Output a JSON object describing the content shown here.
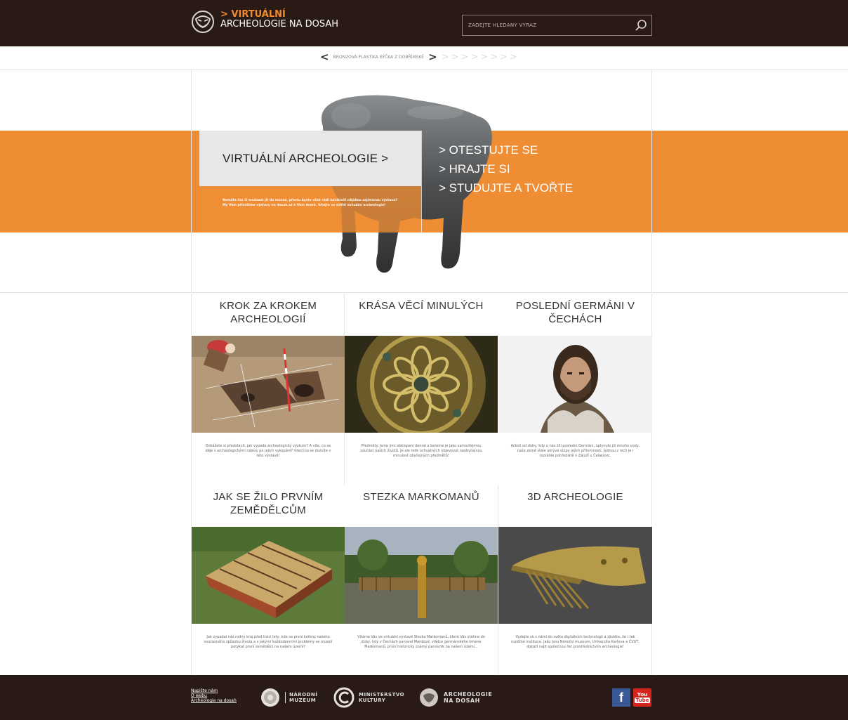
{
  "header": {
    "logo_accent": "> VIRTUÁLNÍ",
    "logo_line2": "ARCHEOLOGIE NA DOSAH",
    "search_placeholder": "ZADEJTE HLEDANÝ VÝRAZ"
  },
  "breadcrumb": {
    "prev": "<",
    "current": "BRONZOVÁ PLASTIKA BÝČKA Z DOBŘÍMSKÉ",
    "next": ">",
    "trail": ">>>>>>>>"
  },
  "hero": {
    "title": "VIRTUÁLNÍ ARCHEOLOGIE   >",
    "intro": "Nemáte čas či možnost jít do muzea, přesto byste však rádi navštívili nějakou zajímavou výstavu? My Vám přinášíme výstavy na dosah až k Vám domů. Vítejte ve světě virtuální archeologie!",
    "menu": [
      "> OTESTUJTE SE",
      "> HRAJTE SI",
      "> STUDUJTE A TVOŘTE"
    ]
  },
  "cards": [
    {
      "title": "KROK ZA KROKEM ARCHEOLOGIÍ",
      "desc": "Dokážete si představit, jak vypadá archeologický výzkum? A víte, co se děje s archeologickými nálezy po jejich vykopání? Všechno se dozvíte v této výstavě!"
    },
    {
      "title": "KRÁSA VĚCÍ MINULÝCH",
      "desc": "Předměty. Jsme jimi obklopeni denně a bereme je jako samozřejmou součást našich životů. Je ale tolik úchvatných objevovat neobyčejnou minulost obyčejných předmětů!"
    },
    {
      "title": "POSLEDNÍ GERMÁNI V ČECHÁCH",
      "desc": "Ačkoli od doby, kdy u nás žili poslední Germáni, uplynulo již mnoho vody, naše země stále ukrývá stopy jejich přítomnosti. Jednou z nich je i rozsáhlé pohřebiště v Záluží u Čelákovic."
    },
    {
      "title": "JAK SE ŽILO PRVNÍM ZEMĚDĚLCŮM",
      "desc": "Jak vypadal náš rodný kraj před tisíci lety, kde se první kořeny našeho současného způsobu života a s jakými každodenními problémy se museli potýkat první zemědělci na našem území?"
    },
    {
      "title": "STEZKA MARKOMANŮ",
      "desc": "Vítáme Vás ve virtuální výstavě Stezka Markomanů, která Vás vtáhne do doby, kdy v Čechách panoval Marobud, vládce germánského kmene Markomanů, první historicky známý panovník na našem území..."
    },
    {
      "title": "3D ARCHEOLOGIE",
      "desc": "Vydejte se s námi do světa digitálních technologií a zjistěte, že i tak rozdílné instituce, jako jsou Národní muzeum, Univerzita Karlova a ČVUT, dokáží najít společnou řeč prostřednictvím archeologie!"
    }
  ],
  "footer": {
    "links": [
      "Napište nám",
      "O webu",
      "Archeologie na dosah"
    ],
    "nm_logo": [
      "NÁRODNÍ",
      "MUZEUM"
    ],
    "mk_logo": [
      "MINISTERSTVO",
      "KULTURY"
    ],
    "and_logo": [
      "ARCHEOLOGIE",
      "NA DOSAH"
    ],
    "facebook": "f",
    "youtube": [
      "You",
      "Tube"
    ]
  },
  "colors": {
    "orange": "#ee8d33",
    "dark": "#2a1a16"
  }
}
